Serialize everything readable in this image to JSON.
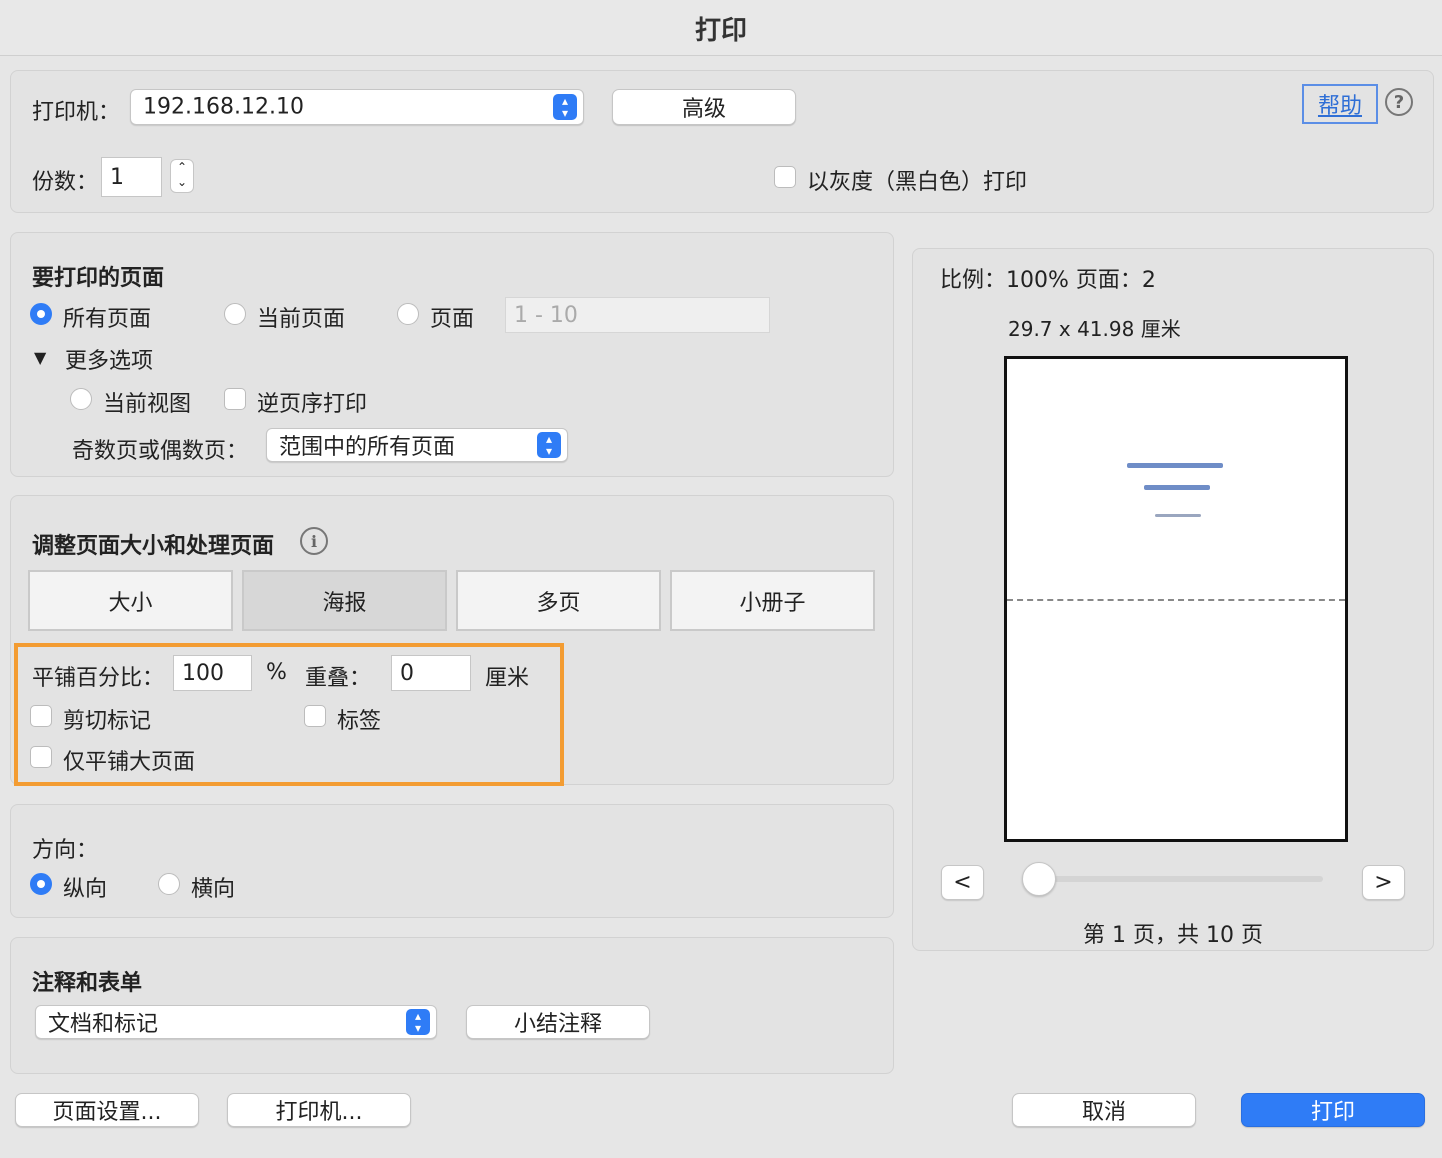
{
  "window": {
    "title": "打印"
  },
  "top": {
    "printer_label": "打印机：",
    "printer_value": "192.168.12.10",
    "advanced_button": "高级",
    "help_link": "帮助",
    "help_icon": "question-circle-icon",
    "copies_label": "份数：",
    "copies_value": "1",
    "grayscale_label": "以灰度（黑白色）打印",
    "grayscale_checked": false
  },
  "pages_section": {
    "title": "要打印的页面",
    "all_pages": "所有页面",
    "current_page": "当前页面",
    "pages": "页面",
    "pages_placeholder": "1 - 10",
    "selected": "all",
    "more_options": "更多选项",
    "current_view": "当前视图",
    "reverse_order": "逆页序打印",
    "odd_even_label": "奇数页或偶数页：",
    "odd_even_value": "范围中的所有页面"
  },
  "sizing_section": {
    "title": "调整页面大小和处理页面",
    "info_icon": "info-icon",
    "tabs": [
      "大小",
      "海报",
      "多页",
      "小册子"
    ],
    "active_tab": "海报",
    "tile_percent_label": "平铺百分比：",
    "tile_percent_value": "100",
    "percent_unit": "%",
    "overlap_label": "重叠：",
    "overlap_value": "0",
    "overlap_unit": "厘米",
    "cut_marks": "剪切标记",
    "labels": "标签",
    "tile_large_only": "仅平铺大页面"
  },
  "orientation_section": {
    "title": "方向：",
    "portrait": "纵向",
    "landscape": "横向",
    "selected": "portrait"
  },
  "annotations_section": {
    "title": "注释和表单",
    "select_value": "文档和标记",
    "summarize_button": "小结注释"
  },
  "preview": {
    "scale_text": "比例：100% 页面：2",
    "size_text": "29.7 x 41.98 厘米",
    "prev_button": "<",
    "next_button": ">",
    "page_indicator": "第 1 页，共 10 页",
    "slider_position": 0
  },
  "bottom": {
    "page_setup": "页面设置...",
    "printer": "打印机...",
    "cancel": "取消",
    "print": "打印"
  },
  "colors": {
    "accent": "#2f7cf6",
    "highlight": "#f39c32"
  }
}
